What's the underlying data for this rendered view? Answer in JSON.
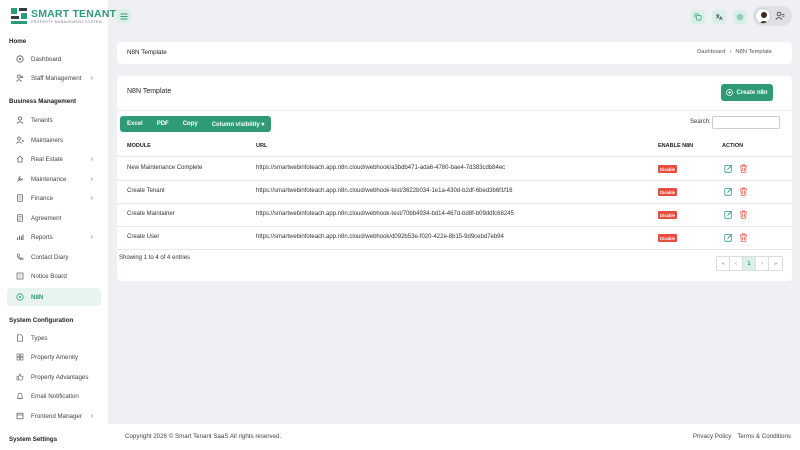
{
  "brand": {
    "title": "SMART TENANT",
    "subtitle": "PROPERTY MANAGEMENT SYSTEM"
  },
  "sidebar": {
    "sections": [
      {
        "label": "Home"
      },
      {
        "label": "Business Management"
      },
      {
        "label": "System Configuration"
      },
      {
        "label": "System Settings"
      }
    ],
    "items": [
      {
        "label": "Dashboard",
        "icon": "dashboard-icon"
      },
      {
        "label": "Staff Management",
        "icon": "users-icon",
        "chevron": "›"
      },
      {
        "label": "Tenants",
        "icon": "user-icon"
      },
      {
        "label": "Maintainers",
        "icon": "user-gear-icon"
      },
      {
        "label": "Real Estate",
        "icon": "home-icon",
        "chevron": "›"
      },
      {
        "label": "Maintenance",
        "icon": "wrench-icon",
        "chevron": "›"
      },
      {
        "label": "Finance",
        "icon": "finance-icon",
        "chevron": "›"
      },
      {
        "label": "Agreement",
        "icon": "agreement-icon"
      },
      {
        "label": "Reports",
        "icon": "reports-icon",
        "chevron": "›"
      },
      {
        "label": "Contact Diary",
        "icon": "phone-icon"
      },
      {
        "label": "Notice Board",
        "icon": "notice-icon"
      },
      {
        "label": "N8N",
        "icon": "n8n-icon",
        "active": true
      },
      {
        "label": "Types",
        "icon": "types-icon"
      },
      {
        "label": "Property Amenity",
        "icon": "amenity-icon"
      },
      {
        "label": "Property Advantages",
        "icon": "thumbs-up-icon"
      },
      {
        "label": "Email Notification",
        "icon": "bell-icon"
      },
      {
        "label": "Frontend Manager",
        "icon": "frontend-icon",
        "chevron": "›"
      }
    ]
  },
  "breadcrumb": {
    "title": "N8N Template",
    "home": "Dashboard",
    "separator": "›",
    "current": "N8N Template"
  },
  "card": {
    "title": "N8N Template",
    "create_label": "Create n8n"
  },
  "toolbar": {
    "buttons": [
      "Excel",
      "PDF",
      "Copy",
      "Column visibility ▾"
    ],
    "search_label": "Search:",
    "search_value": ""
  },
  "table": {
    "headers": {
      "module": "MODULE",
      "url": "URL",
      "enable": "ENABLE N8N",
      "action": "ACTION"
    },
    "rows": [
      {
        "module": "New Maintenance Complete",
        "url": "https://smartwebinfoteach.app.n8n.cloud/webhook/a3bdb471-ada6-4780-bae4-7d383cdb84ec",
        "status": "Disable"
      },
      {
        "module": "Create Tenant",
        "url": "https://smartwebinfoteach.app.n8n.cloud/webhook-test/3622b034-1e1a-430d-b2df-6bed3b6f1f16",
        "status": "Disable"
      },
      {
        "module": "Create Maintainer",
        "url": "https://smartwebinfoteach.app.n8n.cloud/webhook-test/70bb4934-bd14-467d-bd8f-b09ddfc68245",
        "status": "Disable"
      },
      {
        "module": "Create User",
        "url": "https://smartwebinfoteach.app.n8n.cloud/webhook/d092b53e-f020-422e-8b15-9d9cebd7eb94",
        "status": "Disable"
      }
    ]
  },
  "pagination": {
    "info": "Showing 1 to 4 of 4 entries",
    "first": "«",
    "prev": "‹",
    "current": "1",
    "next": "›",
    "last": "»"
  },
  "footer": {
    "copyright": "Copyright 2026 © Smart Tenant SaaS All rights reserved.",
    "privacy": "Privacy Policy",
    "terms": "Terms & Conditions"
  },
  "colors": {
    "accent": "#2e9b76",
    "accent_light": "#d9efe7",
    "danger": "#e74c3c",
    "background": "#eef0f3"
  }
}
